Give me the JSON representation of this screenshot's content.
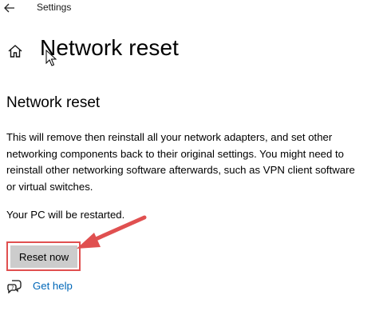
{
  "titlebar": {
    "back_icon": "back-arrow-icon",
    "app_title": "Settings"
  },
  "header": {
    "home_icon": "home-icon",
    "page_title": "Network reset"
  },
  "section": {
    "title": "Network reset",
    "description": "This will remove then reinstall all your network adapters, and set other networking components back to their original settings. You might need to reinstall other networking software afterwards, such as VPN client software or virtual switches.",
    "restart_note": "Your PC will be restarted."
  },
  "actions": {
    "reset_label": "Reset now"
  },
  "help": {
    "icon": "help-chat-icon",
    "label": "Get help"
  },
  "annotation": {
    "highlight_color": "#e05050",
    "arrow_color": "#e05050"
  },
  "colors": {
    "link": "#0067b8",
    "button_bg": "#cccccc"
  }
}
